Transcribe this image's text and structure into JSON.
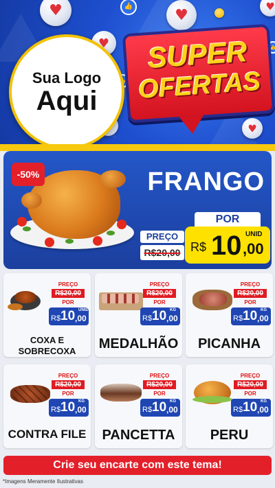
{
  "header": {
    "logo_line1": "Sua Logo",
    "logo_line2": "Aqui",
    "badge_line1": "SUPER",
    "badge_line2": "OFERTAS"
  },
  "featured": {
    "discount": "-50%",
    "name": "FRANGO",
    "old_price_label": "PREÇO",
    "old_price": "R$20,00",
    "new_price_label": "POR",
    "currency": "R$",
    "price_int": "10",
    "price_dec": ",00",
    "unit": "UNID"
  },
  "products": [
    {
      "name_lines": [
        "COXA E",
        "SOBRECOXA"
      ],
      "preco_label": "PREÇO",
      "old_price": "R$20,00",
      "por_label": "POR",
      "currency": "R$",
      "price_int": "10",
      "price_dec": ",00",
      "unit": "UNID"
    },
    {
      "name_lines": [
        "MEDALHÃO"
      ],
      "preco_label": "PREÇO",
      "old_price": "R$20,00",
      "por_label": "POR",
      "currency": "R$",
      "price_int": "10",
      "price_dec": ",00",
      "unit": "KG"
    },
    {
      "name_lines": [
        "PICANHA"
      ],
      "preco_label": "PREÇO",
      "old_price": "R$20,00",
      "por_label": "POR",
      "currency": "R$",
      "price_int": "10",
      "price_dec": ",00",
      "unit": "KG"
    },
    {
      "name_lines": [
        "CONTRA FILE"
      ],
      "preco_label": "PREÇO",
      "old_price": "R$20,00",
      "por_label": "POR",
      "currency": "R$",
      "price_int": "10",
      "price_dec": ",00",
      "unit": "KG"
    },
    {
      "name_lines": [
        "PANCETTA"
      ],
      "preco_label": "PREÇO",
      "old_price": "R$20,00",
      "por_label": "POR",
      "currency": "R$",
      "price_int": "10",
      "price_dec": ",00",
      "unit": "KG"
    },
    {
      "name_lines": [
        "PERU"
      ],
      "preco_label": "PREÇO",
      "old_price": "R$20,00",
      "por_label": "POR",
      "currency": "R$",
      "price_int": "10",
      "price_dec": ",00",
      "unit": "KG"
    }
  ],
  "footer": {
    "banner": "Crie seu encarte com este tema!",
    "disclaimer": "*Imagens Meramente Ilustrativas"
  },
  "colors": {
    "brand_blue": "#1f46b3",
    "accent_red": "#e3202a",
    "highlight_yellow": "#ffe100"
  },
  "icons": [
    "heart-icon",
    "like-icon",
    "emoji-icon"
  ]
}
